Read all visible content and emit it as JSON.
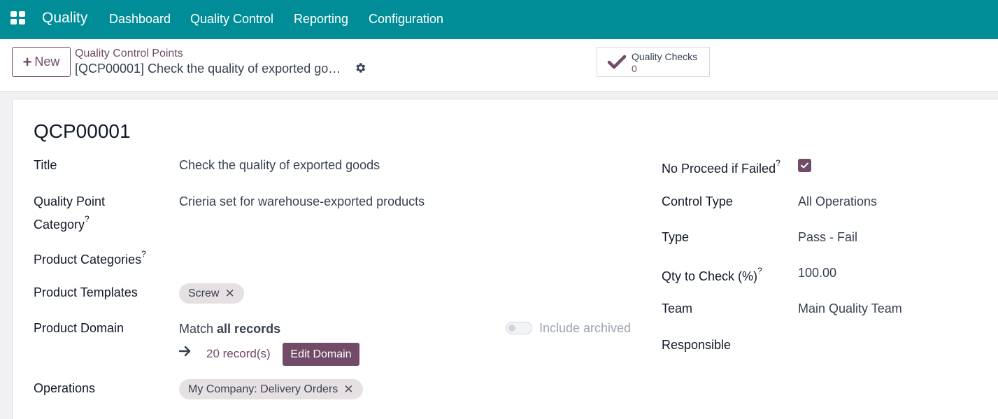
{
  "navbar": {
    "app_name": "Quality",
    "menu": [
      "Dashboard",
      "Quality Control",
      "Reporting",
      "Configuration"
    ]
  },
  "control_panel": {
    "new_label": "New",
    "breadcrumb": "Quality Control Points",
    "record_title": "[QCP00001] Check the quality of exported go…",
    "smart_button": {
      "label": "Quality Checks",
      "count": "0"
    }
  },
  "form": {
    "reference": "QCP00001",
    "title": {
      "label": "Title",
      "value": "Check the quality of exported goods"
    },
    "quality_point_category": {
      "label_line1": "Quality Point",
      "label_line2": "Category",
      "help": "?",
      "value": "Crieria set for warehouse-exported products"
    },
    "product_categories": {
      "label": "Product Categories",
      "help": "?"
    },
    "product_templates": {
      "label": "Product Templates",
      "tags": [
        "Screw"
      ]
    },
    "product_domain": {
      "label": "Product Domain",
      "match_prefix": "Match",
      "match_bold": "all records",
      "include_archived": "Include archived",
      "include_archived_on": false,
      "records": "20 record(s)",
      "edit_label": "Edit Domain"
    },
    "operations": {
      "label": "Operations",
      "tags": [
        "My Company: Delivery Orders"
      ]
    },
    "no_proceed": {
      "label": "No Proceed if Failed",
      "help": "?",
      "checked": true
    },
    "control_type": {
      "label": "Control Type",
      "value": "All Operations"
    },
    "type": {
      "label": "Type",
      "value": "Pass - Fail"
    },
    "qty_to_check": {
      "label": "Qty to Check (%)",
      "help": "?",
      "value": "100.00"
    },
    "team": {
      "label": "Team",
      "value": "Main Quality Team"
    },
    "responsible": {
      "label": "Responsible",
      "value": ""
    }
  },
  "colors": {
    "navbar": "#018d98",
    "brand": "#714b67"
  }
}
